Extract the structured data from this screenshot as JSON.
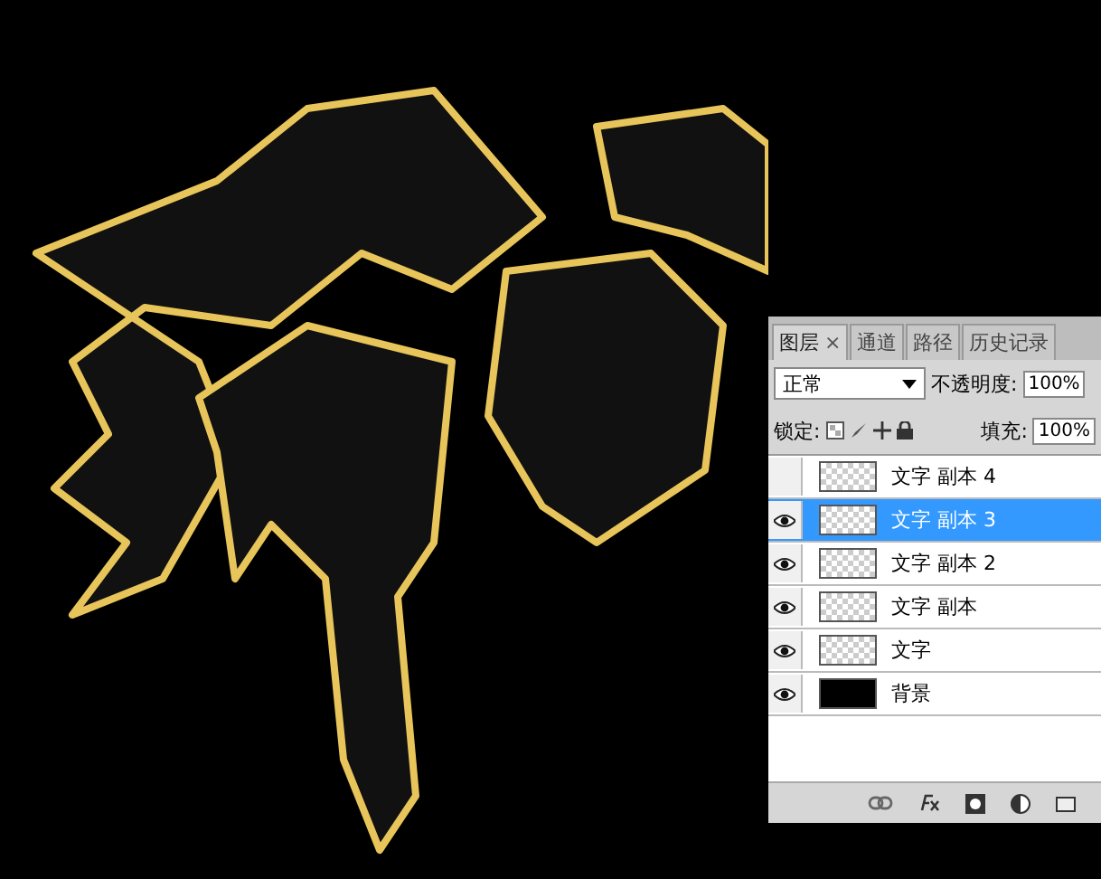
{
  "panel": {
    "tabs": [
      {
        "label": "图层",
        "selected": true,
        "close": "×"
      },
      {
        "label": "通道",
        "selected": false
      },
      {
        "label": "路径",
        "selected": false
      },
      {
        "label": "历史记录",
        "selected": false
      }
    ],
    "blend_mode": "正常",
    "opacity_label": "不透明度:",
    "opacity": "100%",
    "lock_label": "锁定:",
    "fill_label": "填充:",
    "fill": "100%",
    "layers": [
      {
        "name": "文字 副本 4",
        "visible": false,
        "selected": false,
        "kind": "transparent"
      },
      {
        "name": "文字 副本 3",
        "visible": true,
        "selected": true,
        "kind": "transparent"
      },
      {
        "name": "文字 副本 2",
        "visible": true,
        "selected": false,
        "kind": "transparent"
      },
      {
        "name": "文字 副本",
        "visible": true,
        "selected": false,
        "kind": "transparent"
      },
      {
        "name": "文字",
        "visible": true,
        "selected": false,
        "kind": "transparent"
      },
      {
        "name": "背景",
        "visible": true,
        "selected": false,
        "kind": "solid"
      }
    ]
  }
}
